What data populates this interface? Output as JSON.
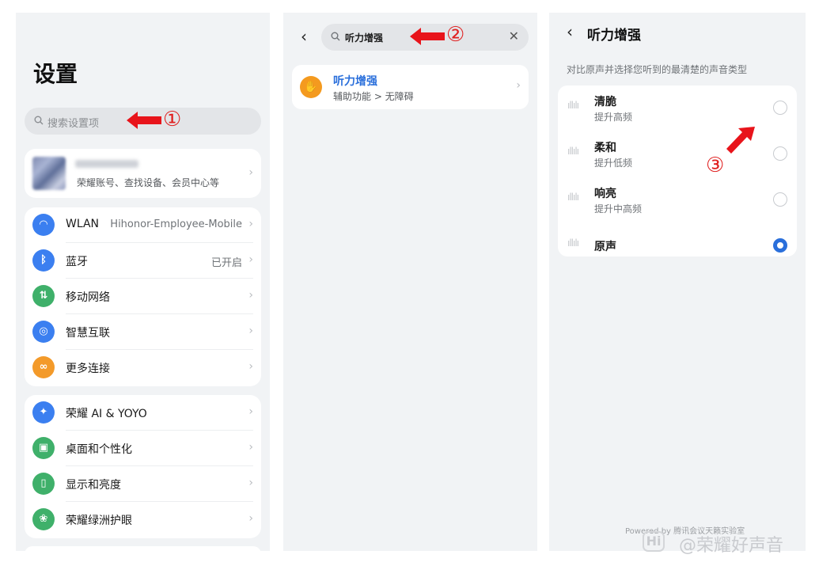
{
  "panel1": {
    "title": "设置",
    "search_placeholder": "搜索设置项",
    "account_text": "荣耀账号、查找设备、会员中心等",
    "group1": [
      {
        "label": "WLAN",
        "value": "Hihonor-Employee-Mobile",
        "icon": "wifi-icon",
        "color": "#3b7ff0"
      },
      {
        "label": "蓝牙",
        "value": "已开启",
        "icon": "bluetooth-icon",
        "color": "#3b7ff0"
      },
      {
        "label": "移动网络",
        "value": "",
        "icon": "mobile-network-icon",
        "color": "#3fb06a"
      },
      {
        "label": "智慧互联",
        "value": "",
        "icon": "smart-connect-icon",
        "color": "#3b7ff0"
      },
      {
        "label": "更多连接",
        "value": "",
        "icon": "link-icon",
        "color": "#f39a2a"
      }
    ],
    "group2": [
      {
        "label": "荣耀 AI & YOYO",
        "icon": "ai-sparkle-icon",
        "color": "#3b7ff0"
      },
      {
        "label": "桌面和个性化",
        "icon": "image-icon",
        "color": "#3fb06a"
      },
      {
        "label": "显示和亮度",
        "icon": "display-icon",
        "color": "#3fb06a"
      },
      {
        "label": "荣耀绿洲护眼",
        "icon": "eye-care-icon",
        "color": "#3fb06a"
      }
    ]
  },
  "panel2": {
    "query": "听力增强",
    "result_title": "听力增强",
    "result_path": "辅助功能 > 无障碍"
  },
  "panel3": {
    "title": "听力增强",
    "description": "对比原声并选择您听到的最清楚的声音类型",
    "options": [
      {
        "name": "清脆",
        "sub": "提升高频",
        "selected": false
      },
      {
        "name": "柔和",
        "sub": "提升低频",
        "selected": false
      },
      {
        "name": "响亮",
        "sub": "提升中高频",
        "selected": false
      },
      {
        "name": "原声",
        "sub": "",
        "selected": true
      }
    ],
    "powered": "Powered by 腾讯会议天籁实验室"
  },
  "annotations": {
    "step1": "①",
    "step2": "②",
    "step3": "③",
    "arrow_color": "#e8141b"
  },
  "watermark": "@荣耀好声音",
  "watermark_logo": "Hi",
  "glyphs": {
    "chevron": "›",
    "back": "‹",
    "clear": "✕",
    "hand": "✋",
    "wave": "ıllılı"
  },
  "icon_glyphs": {
    "wifi-icon": "◠",
    "bluetooth-icon": "ᛒ",
    "mobile-network-icon": "⇅",
    "smart-connect-icon": "◎",
    "link-icon": "∞",
    "ai-sparkle-icon": "✦",
    "image-icon": "▣",
    "display-icon": "▯",
    "eye-care-icon": "❀"
  }
}
